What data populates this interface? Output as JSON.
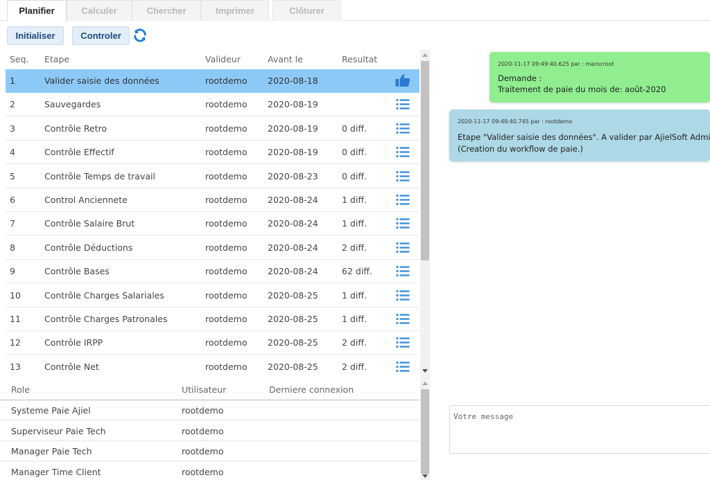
{
  "tabs": [
    {
      "label": "Planifier"
    },
    {
      "label": "Calculer"
    },
    {
      "label": "Chercher"
    },
    {
      "label": "Imprimer"
    },
    {
      "label": "Clôturer"
    }
  ],
  "toolbar": {
    "init_label": "Initialiser",
    "control_label": "Controler",
    "refresh_icon": "refresh-icon"
  },
  "steps": {
    "headers": {
      "seq": "Seq.",
      "etape": "Etape",
      "valideur": "Valideur",
      "avant": "Avant le",
      "resultat": "Resultat"
    },
    "rows": [
      {
        "seq": "1",
        "etape": "Valider saisie des données",
        "valideur": "rootdemo",
        "avant": "2020-08-18",
        "resultat": "",
        "icon": "thumbs-up-icon"
      },
      {
        "seq": "2",
        "etape": "Sauvegardes",
        "valideur": "rootdemo",
        "avant": "2020-08-19",
        "resultat": "",
        "icon": "list-icon"
      },
      {
        "seq": "3",
        "etape": "Contrôle Retro",
        "valideur": "rootdemo",
        "avant": "2020-08-19",
        "resultat": "0 diff.",
        "icon": "list-icon"
      },
      {
        "seq": "4",
        "etape": "Contrôle Effectif",
        "valideur": "rootdemo",
        "avant": "2020-08-19",
        "resultat": "0 diff.",
        "icon": "list-icon"
      },
      {
        "seq": "5",
        "etape": "Contrôle Temps de travail",
        "valideur": "rootdemo",
        "avant": "2020-08-23",
        "resultat": "0 diff.",
        "icon": "list-icon"
      },
      {
        "seq": "6",
        "etape": "Control Anciennete",
        "valideur": "rootdemo",
        "avant": "2020-08-24",
        "resultat": "1 diff.",
        "icon": "list-icon"
      },
      {
        "seq": "7",
        "etape": "Contrôle Salaire Brut",
        "valideur": "rootdemo",
        "avant": "2020-08-24",
        "resultat": "1 diff.",
        "icon": "list-icon"
      },
      {
        "seq": "8",
        "etape": "Contrôle Déductions",
        "valideur": "rootdemo",
        "avant": "2020-08-24",
        "resultat": "2 diff.",
        "icon": "list-icon"
      },
      {
        "seq": "9",
        "etape": "Contrôle Bases",
        "valideur": "rootdemo",
        "avant": "2020-08-24",
        "resultat": "62 diff.",
        "icon": "list-icon"
      },
      {
        "seq": "10",
        "etape": "Contrôle Charges Salariales",
        "valideur": "rootdemo",
        "avant": "2020-08-25",
        "resultat": "1 diff.",
        "icon": "list-icon"
      },
      {
        "seq": "11",
        "etape": "Contrôle Charges Patronales",
        "valideur": "rootdemo",
        "avant": "2020-08-25",
        "resultat": "1 diff.",
        "icon": "list-icon"
      },
      {
        "seq": "12",
        "etape": "Contrôle IRPP",
        "valideur": "rootdemo",
        "avant": "2020-08-25",
        "resultat": "2 diff.",
        "icon": "list-icon"
      },
      {
        "seq": "13",
        "etape": "Contrôle Net",
        "valideur": "rootdemo",
        "avant": "2020-08-25",
        "resultat": "2 diff.",
        "icon": "list-icon"
      }
    ]
  },
  "roles": {
    "headers": {
      "role": "Role",
      "utilisateur": "Utilisateur",
      "connexion": "Derniere connexion"
    },
    "rows": [
      {
        "role": "Systeme Paie Ajiel",
        "utilisateur": "rootdemo",
        "connexion": ""
      },
      {
        "role": "Superviseur Paie Tech",
        "utilisateur": "rootdemo",
        "connexion": ""
      },
      {
        "role": "Manager Paie Tech",
        "utilisateur": "rootdemo",
        "connexion": ""
      },
      {
        "role": "Manager Time Client",
        "utilisateur": "rootdemo",
        "connexion": ""
      }
    ]
  },
  "messages": [
    {
      "meta": "2020-11-17 09:49:40.625 par : marocroot",
      "lines": [
        "Demande :",
        "Traitement de paie du mois de: août-2020"
      ],
      "color": "#90ee90"
    },
    {
      "meta": "2020-11-17 09:49:40.745 par : rootdemo",
      "lines": [
        "Etape \"Valider saisie des données\". A valider par AjielSoft Admin",
        " (Creation du workflow de paie.)"
      ],
      "color": "#add8e6"
    }
  ],
  "composer": {
    "placeholder": "Votre message"
  },
  "colors": {
    "selected_row": "#8dc9f7",
    "icon_blue": "#3b8fd9",
    "button_bg": "#e3eef9"
  }
}
